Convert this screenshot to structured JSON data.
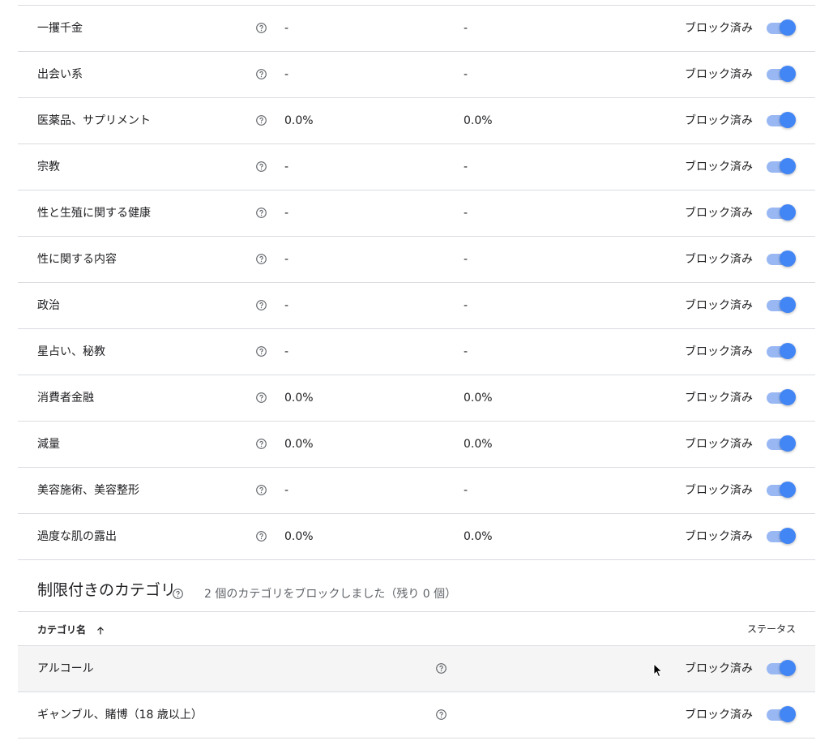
{
  "categories": [
    {
      "name": "一攫千金",
      "v1": "-",
      "v2": "-",
      "status": "ブロック済み"
    },
    {
      "name": "出会い系",
      "v1": "-",
      "v2": "-",
      "status": "ブロック済み"
    },
    {
      "name": "医薬品、サプリメント",
      "v1": "0.0%",
      "v2": "0.0%",
      "status": "ブロック済み"
    },
    {
      "name": "宗教",
      "v1": "-",
      "v2": "-",
      "status": "ブロック済み"
    },
    {
      "name": "性と生殖に関する健康",
      "v1": "-",
      "v2": "-",
      "status": "ブロック済み"
    },
    {
      "name": "性に関する内容",
      "v1": "-",
      "v2": "-",
      "status": "ブロック済み"
    },
    {
      "name": "政治",
      "v1": "-",
      "v2": "-",
      "status": "ブロック済み"
    },
    {
      "name": "星占い、秘教",
      "v1": "-",
      "v2": "-",
      "status": "ブロック済み"
    },
    {
      "name": "消費者金融",
      "v1": "0.0%",
      "v2": "0.0%",
      "status": "ブロック済み"
    },
    {
      "name": "減量",
      "v1": "0.0%",
      "v2": "0.0%",
      "status": "ブロック済み"
    },
    {
      "name": "美容施術、美容整形",
      "v1": "-",
      "v2": "-",
      "status": "ブロック済み"
    },
    {
      "name": "過度な肌の露出",
      "v1": "0.0%",
      "v2": "0.0%",
      "status": "ブロック済み"
    }
  ],
  "restricted": {
    "title": "制限付きのカテゴリ",
    "summary": "2 個のカテゴリをブロックしました（残り 0 個）",
    "col_name": "カテゴリ名",
    "col_status": "ステータス",
    "rows": [
      {
        "name": "アルコール",
        "status": "ブロック済み"
      },
      {
        "name": "ギャンブル、賭博（18 歳以上）",
        "status": "ブロック済み"
      }
    ]
  },
  "icons": {
    "help": "help-circle-icon",
    "sort": "arrow-up-icon",
    "cursor": "mouse-pointer-icon"
  },
  "colors": {
    "toggle_on": "#4285f4",
    "toggle_track": "#99b8f3",
    "divider": "#dadce0",
    "hover_row": "#f5f5f5"
  }
}
